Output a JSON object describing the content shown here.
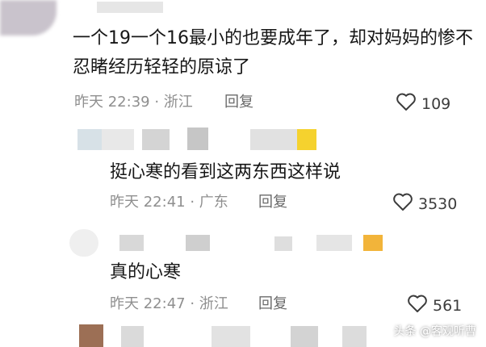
{
  "comments": [
    {
      "text_line1": "一个19一个16最小的也要成年了，却对妈妈的惨不",
      "text_line2": "忍睹经历轻轻的原谅了",
      "meta": "昨天 22:39 · 浙江",
      "reply_label": "回复",
      "likes": "109"
    },
    {
      "text_line1": "挺心寒的看到这两东西这样说",
      "meta": "昨天 22:41 · 广东",
      "reply_label": "回复",
      "likes": "3530"
    },
    {
      "text_line1": "真的心寒",
      "meta": "昨天 22:47 · 浙江",
      "reply_label": "回复",
      "likes": "561"
    }
  ],
  "watermark": "头条 @客观听曹",
  "icons": {
    "like": "heart-outline-icon"
  },
  "colors": {
    "text": "#161616",
    "meta": "#8f8f8f",
    "accent_yellow": "#f5d22e"
  }
}
